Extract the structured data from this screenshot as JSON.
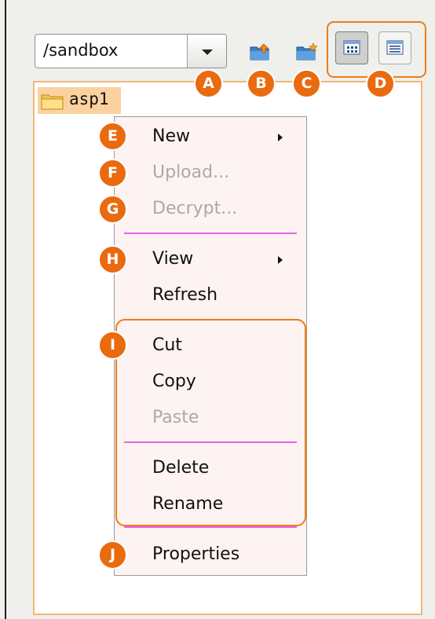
{
  "colors": {
    "accent": "#ef7d12",
    "badge_fill": "#ea6a10",
    "selection": "#fbd29f",
    "separator": "#e463ea",
    "menu_bg": "#fdf3f3",
    "disabled_text": "#a9a9a9"
  },
  "toolbar": {
    "path_value": "/sandbox",
    "dropdown_icon": "chevron-down-icon",
    "upload_folder_icon": "folder-upload-icon",
    "new_folder_icon": "folder-new-icon",
    "views": [
      {
        "icon": "icon-grid-view-icon",
        "active": true
      },
      {
        "icon": "list-view-icon",
        "active": false
      }
    ]
  },
  "tree": {
    "items": [
      {
        "label": "asp1",
        "icon": "folder-icon",
        "selected": true
      }
    ]
  },
  "context_menu": {
    "new": "New",
    "upload": "Upload...",
    "decrypt": "Decrypt...",
    "view": "View",
    "refresh": "Refresh",
    "cut": "Cut",
    "copy": "Copy",
    "paste": "Paste",
    "delete": "Delete",
    "rename": "Rename",
    "properties": "Properties",
    "disabled_items": [
      "Upload...",
      "Decrypt...",
      "Paste"
    ]
  },
  "callouts": {
    "a": "A",
    "b": "B",
    "c": "C",
    "d": "D",
    "e": "E",
    "f": "F",
    "g": "G",
    "h": "H",
    "i": "I",
    "j": "J"
  }
}
